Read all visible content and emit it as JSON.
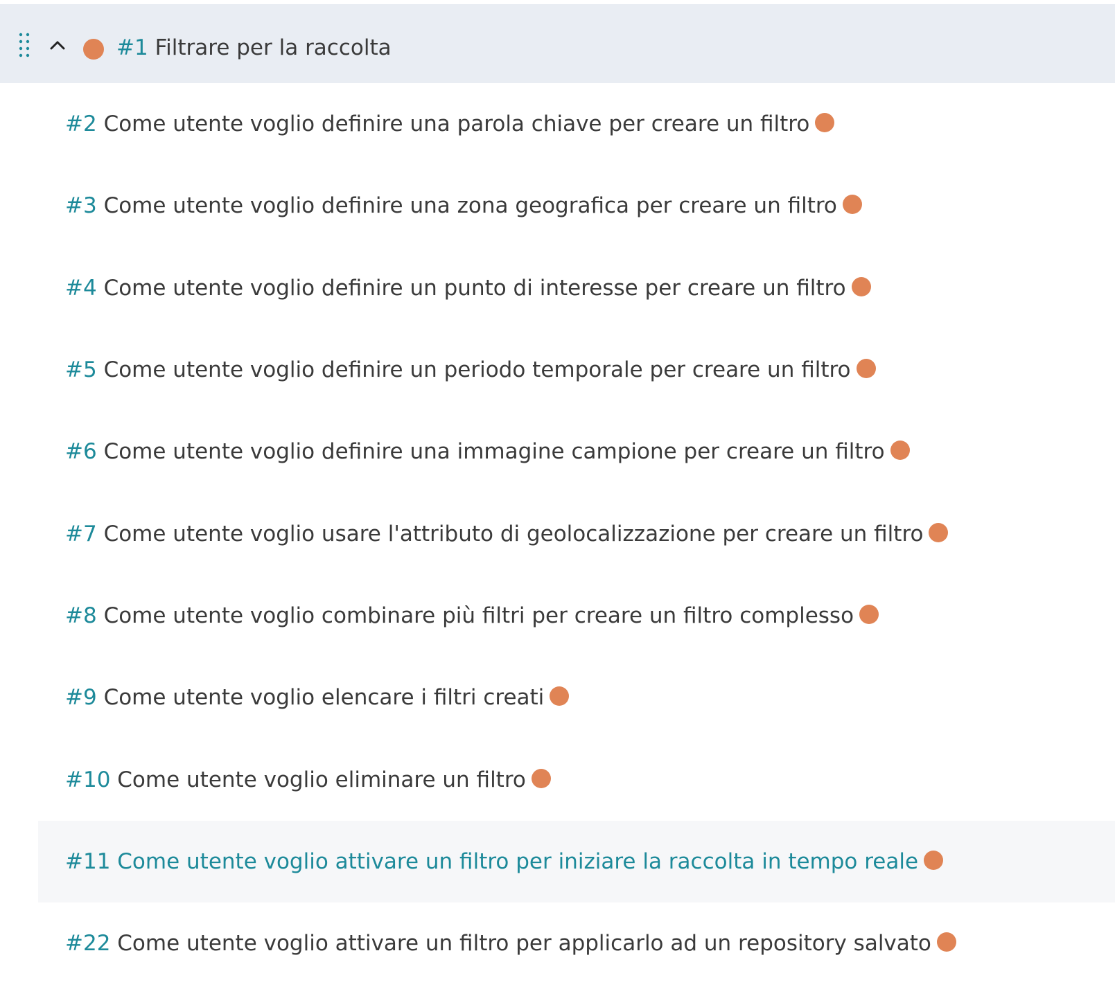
{
  "colors": {
    "status_dot": "#e08455",
    "ref": "#1d8a9a",
    "header_bg": "#e9edf3",
    "highlight_bg": "#f6f7f9"
  },
  "icons": {
    "drag_handle": "drag-handle-icon",
    "collapse": "chevron-up-icon",
    "status": "status-dot-icon"
  },
  "epic": {
    "ref": "#1",
    "title": "Filtrare per la raccolta",
    "expanded": true
  },
  "stories": [
    {
      "ref": "#2",
      "title": "Come utente voglio definire una parola chiave per creare un filtro"
    },
    {
      "ref": "#3",
      "title": "Come utente voglio definire una zona geografica per creare un filtro"
    },
    {
      "ref": "#4",
      "title": "Come utente voglio definire un punto di interesse per creare un filtro"
    },
    {
      "ref": "#5",
      "title": "Come utente voglio definire un periodo temporale per creare un filtro"
    },
    {
      "ref": "#6",
      "title": "Come utente voglio definire una immagine campione per creare un filtro"
    },
    {
      "ref": "#7",
      "title": "Come utente voglio usare l'attributo di geolocalizzazione per creare un filtro"
    },
    {
      "ref": "#8",
      "title": "Come utente voglio combinare più filtri per creare un filtro complesso"
    },
    {
      "ref": "#9",
      "title": "Come utente voglio elencare i filtri creati"
    },
    {
      "ref": "#10",
      "title": "Come utente voglio eliminare un filtro"
    },
    {
      "ref": "#11",
      "title": "Come utente voglio attivare un filtro per iniziare la raccolta in tempo reale",
      "highlighted": true
    },
    {
      "ref": "#22",
      "title": "Come utente voglio attivare un filtro per applicarlo ad un repository salvato"
    }
  ]
}
